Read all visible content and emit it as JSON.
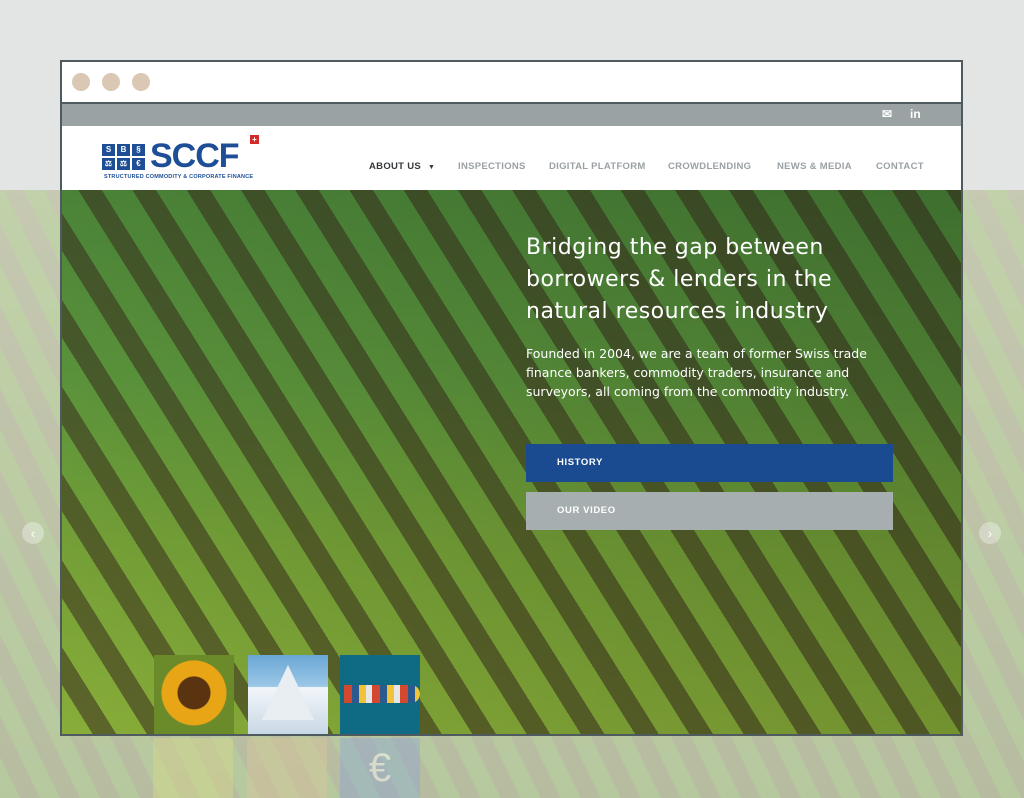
{
  "nav": {
    "logo_text": "SCCF",
    "logo_sub": "STRUCTURED COMMODITY & CORPORATE FINANCE",
    "logo_cells": [
      "S",
      "B",
      "§",
      "⚖",
      "⚖",
      "€"
    ],
    "items": [
      {
        "label": "ABOUT US",
        "active": true
      },
      {
        "label": "INSPECTIONS"
      },
      {
        "label": "DIGITAL PLATFORM"
      },
      {
        "label": "CROWDLENDING"
      },
      {
        "label": "NEWS & MEDIA"
      },
      {
        "label": "CONTACT"
      }
    ],
    "dropdown_icon": "caret-down-icon"
  },
  "topbar": {
    "icons": [
      "mail-icon",
      "linkedin-icon"
    ],
    "linkedin_label": "in"
  },
  "hero": {
    "headline": "Bridging the gap between borrowers & lenders in the natural resources industry",
    "paragraph": "Founded in 2004, we are a team of former Swiss trade finance bankers, commodity traders, insurance and surveyors, all coming from the commodity industry.",
    "buttons": {
      "history": "HISTORY",
      "video": "OUR VIDEO"
    },
    "thumbnails": [
      "sunflower",
      "matterhorn",
      "container-ship"
    ]
  },
  "colors": {
    "brand_blue": "#1a4a8f",
    "button_grey": "#a7aeb0",
    "topbar_grey": "#9aa2a3",
    "window_dot": "#dbc8b4"
  }
}
